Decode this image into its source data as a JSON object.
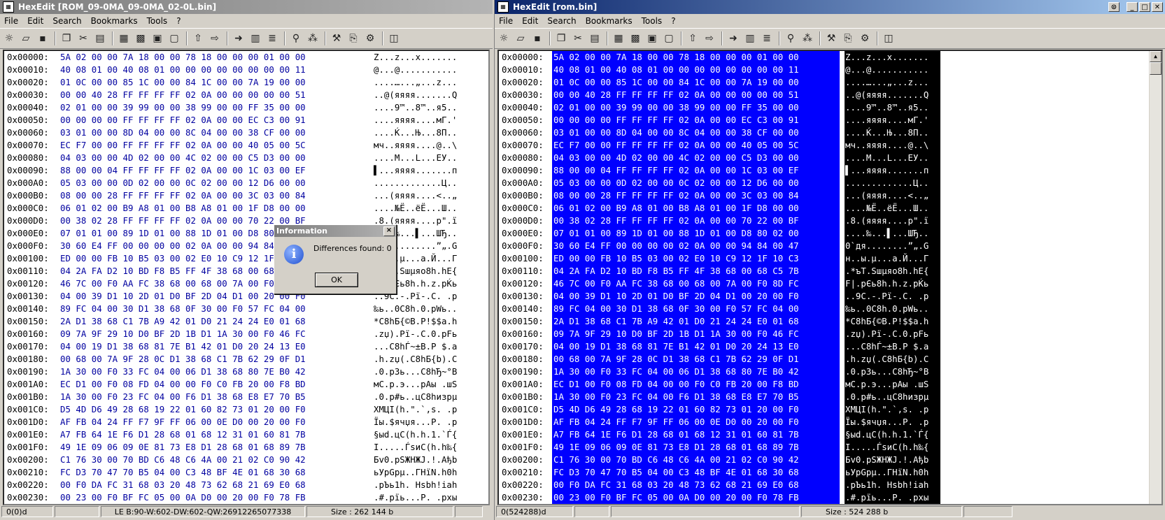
{
  "left": {
    "title": "HexEdit [ROM_09-0MA_09-0MA_02-0L.bin]",
    "status": {
      "pos": "0(0)d",
      "info": "LE B:90-W:602-DW:602-QW:26912265077338",
      "size": "Size : 262 144 b"
    }
  },
  "right": {
    "title": "HexEdit [rom.bin]",
    "status": {
      "pos": "0(524288)d",
      "size": "Size : 524 288 b"
    }
  },
  "menu": [
    "File",
    "Edit",
    "Search",
    "Bookmarks",
    "Tools",
    "?"
  ],
  "dialog": {
    "title": "Information",
    "message": "Differences found: 0",
    "ok": "OK",
    "close": "×",
    "icon": "i"
  },
  "rows": [
    {
      "addr": "0x00000:",
      "hex": "5A 02 00 00 7A 18 00 00 78 18 00 00 00 01 00 00",
      "asc": "Z...z...x......."
    },
    {
      "addr": "0x00010:",
      "hex": "40 08 01 00 40 08 01 00 00 00 00 00 00 00 00 11",
      "asc": "@...@..........."
    },
    {
      "addr": "0x00020:",
      "hex": "01 0C 00 00 85 1C 00 00 84 1C 00 00 7A 19 00 00",
      "asc": "....…...„...z..."
    },
    {
      "addr": "0x00030:",
      "hex": "00 00 40 28 FF FF FF FF 02 0A 00 00 00 00 00 51",
      "asc": "..@(яяяя.......Q"
    },
    {
      "addr": "0x00040:",
      "hex": "02 01 00 00 39 99 00 00 38 99 00 00 FF 35 00 00",
      "asc": "....9™..8™..я5.."
    },
    {
      "addr": "0x00050:",
      "hex": "00 00 00 00 FF FF FF FF 02 0A 00 00 EC C3 00 91",
      "asc": "....яяяя....мГ.'"
    },
    {
      "addr": "0x00060:",
      "hex": "03 01 00 00 8D 04 00 00 8C 04 00 00 38 CF 00 00",
      "asc": "....Ќ...Њ...8П.."
    },
    {
      "addr": "0x00070:",
      "hex": "EC F7 00 00 FF FF FF FF 02 0A 00 00 40 05 00 5C",
      "asc": "мч..яяяя....@..\\"
    },
    {
      "addr": "0x00080:",
      "hex": "04 03 00 00 4D 02 00 00 4C 02 00 00 C5 D3 00 00",
      "asc": "....M...L...ЕУ.."
    },
    {
      "addr": "0x00090:",
      "hex": "88 00 00 04 FF FF FF FF 02 0A 00 00 1C 03 00 EF",
      "asc": "▌...яяяя.......п"
    },
    {
      "addr": "0x000A0:",
      "hex": "05 03 00 00 0D 02 00 00 0C 02 00 00 12 D6 00 00",
      "asc": ".............Ц.."
    },
    {
      "addr": "0x000B0:",
      "hex": "08 00 00 28 FF FF FF FF 02 0A 00 00 3C 03 00 84",
      "asc": "...(яяяя....<..„"
    },
    {
      "addr": "0x000C0:",
      "hex": "06 01 02 00 B9 A8 01 00 B8 A8 01 00 1F D8 00 00",
      "asc": "....№Ё..ёЁ...Ш.."
    },
    {
      "addr": "0x000D0:",
      "hex": "00 38 02 28 FF FF FF FF 02 0A 00 00 70 22 00 BF",
      "asc": ".8.(яяяя....p\".ї"
    },
    {
      "addr": "0x000E0:",
      "hex": "07 01 01 00 89 1D 01 00 88 1D 01 00 D8 80 02 00",
      "asc": "....‰...▌...ШЂ.."
    },
    {
      "addr": "0x000F0:",
      "hex": "30 60 E4 FF 00 00 00 00 02 0A 00 00 94 84 00 47",
      "asc": "0`дя........”„.G"
    },
    {
      "addr": "0x00100:",
      "hex": "ED 00 00 FB 10 B5 03 00 02 E0 10 C9 12 1F 10 C3",
      "asc": "н..ы.µ...а.Й...Г"
    },
    {
      "addr": "0x00110:",
      "hex": "04 2A FA D2 10 BD F8 B5 FF 4F 38 68 00 68 C5 7B",
      "asc": ".*ъТ.Ѕшµяo8h.hЕ{"
    },
    {
      "addr": "0x00120:",
      "hex": "46 7C 00 F0 AA FC 38 68 00 68 00 7A 00 F0 8D FC",
      "asc": "F|.pЄь8h.h.z.pЌь"
    },
    {
      "addr": "0x00130:",
      "hex": "04 00 39 D1 10 2D 01 D0 BF 2D 04 D1 00 20 00 F0",
      "asc": "..9С.-.Рї-.С. .p"
    },
    {
      "addr": "0x00140:",
      "hex": "89 FC 04 00 30 D1 38 68 0F 30 00 F0 57 FC 04 00",
      "asc": "‰ь..0С8h.0.pWь.."
    },
    {
      "addr": "0x00150:",
      "hex": "2A D1 38 68 C1 7B A9 42 01 D0 21 24 24 E0 01 68",
      "asc": "*С8hБ{©B.Р!$$а.h"
    },
    {
      "addr": "0x00160:",
      "hex": "09 7A 9F 29 10 D0 BF 2D 1B D1 1A 30 00 F0 46 FC",
      "asc": ".zџ).Рї-.С.0.pFь"
    },
    {
      "addr": "0x00170:",
      "hex": "04 00 19 D1 38 68 81 7E B1 42 01 D0 20 24 13 E0",
      "asc": "...С8hЃ~±B.Р $.а"
    },
    {
      "addr": "0x00180:",
      "hex": "00 68 00 7A 9F 28 0C D1 38 68 C1 7B 62 29 0F D1",
      "asc": ".h.zџ(.С8hБ{b).С"
    },
    {
      "addr": "0x00190:",
      "hex": "1A 30 00 F0 33 FC 04 00 06 D1 38 68 80 7E B0 42",
      "asc": ".0.p3ь...С8hЂ~°B"
    },
    {
      "addr": "0x001A0:",
      "hex": "EC D1 00 F0 08 FD 04 00 00 F0 C0 FB 20 00 F8 BD",
      "asc": "мС.p.э...pАы .шЅ"
    },
    {
      "addr": "0x001B0:",
      "hex": "1A 30 00 F0 23 FC 04 00 F6 D1 38 68 E8 E7 70 B5",
      "asc": ".0.p#ь..цС8hизpµ"
    },
    {
      "addr": "0x001C0:",
      "hex": "D5 4D D6 49 28 68 19 22 01 60 82 73 01 20 00 F0",
      "asc": "ХМЦI(h.\".`‚s. .p"
    },
    {
      "addr": "0x001D0:",
      "hex": "AF FB 04 24 FF F7 9F FF 06 00 0E D0 00 20 00 F0",
      "asc": "Їы.$ячџя...Р. .p"
    },
    {
      "addr": "0x001E0:",
      "hex": "A7 FB 64 1E F6 D1 28 68 01 68 12 31 01 60 81 7B",
      "asc": "§ыd.цС(h.h.1.`Ѓ{"
    },
    {
      "addr": "0x001F0:",
      "hex": "49 1E 09 06 09 0E 81 73 E8 D1 28 68 01 68 89 7B",
      "asc": "I.....ЃsиС(h.h‰{"
    },
    {
      "addr": "0x00200:",
      "hex": "C1 76 30 00 70 BD C6 48 C6 4A 00 21 02 C0 90 42",
      "asc": "Бv0.pЅЖHЖJ.!.Ађb"
    },
    {
      "addr": "0x00210:",
      "hex": "FC D3 70 47 70 B5 04 00 C3 48 BF 4E 01 68 30 68",
      "asc": "ьУpGpµ..ГHїN.h0h"
    },
    {
      "addr": "0x00220:",
      "hex": "00 F0 DA FC 31 68 03 20 48 73 62 68 21 69 E0 68",
      "asc": ".pЪь1h. Hsbh!iаh"
    },
    {
      "addr": "0x00230:",
      "hex": "00 23 00 F0 BF FC 05 00 0A D0 00 20 00 F0 78 FB",
      "asc": ".#.pїь...Р. .pxы"
    }
  ]
}
